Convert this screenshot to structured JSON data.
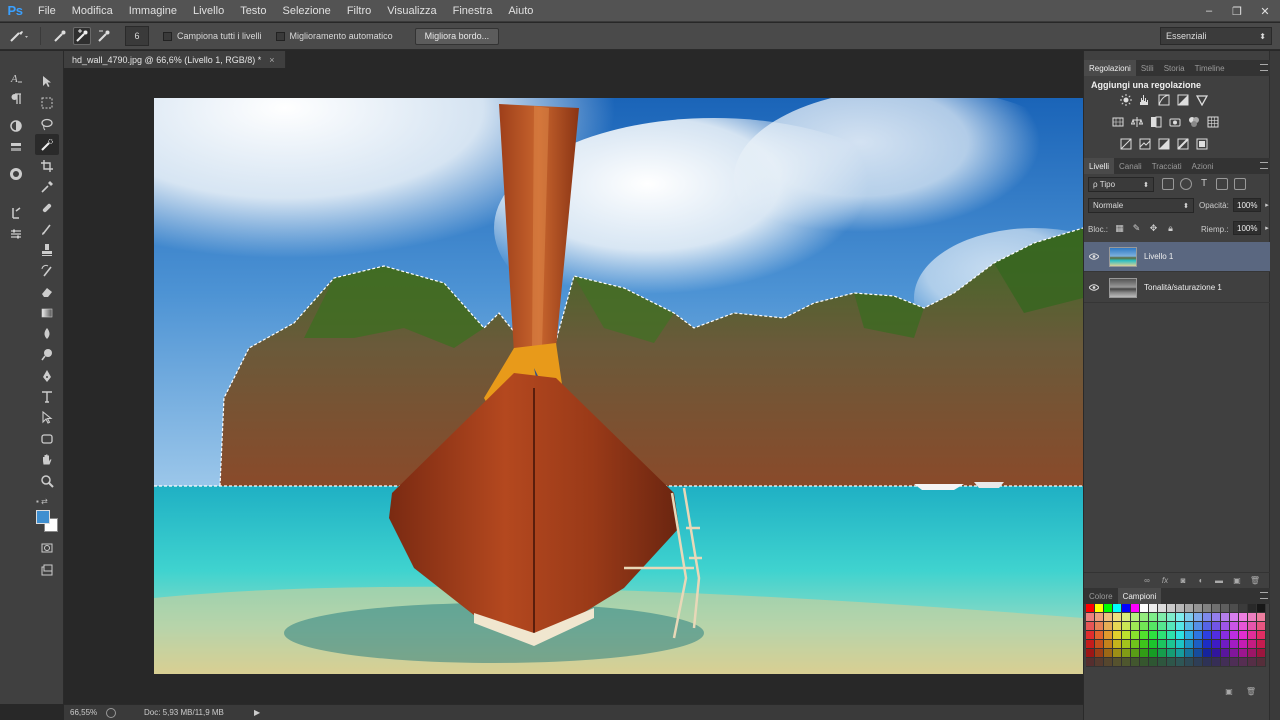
{
  "app": {
    "logo": "Ps"
  },
  "menu": [
    "File",
    "Modifica",
    "Immagine",
    "Livello",
    "Testo",
    "Selezione",
    "Filtro",
    "Visualizza",
    "Finestra",
    "Aiuto"
  ],
  "window": {
    "minimize": "–",
    "restore": "❐",
    "close": "✕"
  },
  "options": {
    "brush_size": "6",
    "sample_all": "Campiona tutti i livelli",
    "auto_enhance": "Miglioramento automatico",
    "refine_edge": "Migliora bordo...",
    "workspace": "Essenziali"
  },
  "document": {
    "tab_title": "hd_wall_4790.jpg @ 66,6% (Livello 1, RGB/8) *",
    "close": "×"
  },
  "status": {
    "zoom": "66,55%",
    "doc_size": "Doc: 5,93 MB/11,9 MB",
    "arrow": "▶"
  },
  "colors": {
    "foreground": "#3f8fd0",
    "background": "#ffffff",
    "accent": "#3aa0ff",
    "selected_layer": "#5a6780"
  },
  "panels": {
    "top_tabs": [
      "Regolazioni",
      "Stili",
      "Storia",
      "Timeline"
    ],
    "adjust_title": "Aggiungi una regolazione",
    "layer_tabs": [
      "Livelli",
      "Canali",
      "Tracciati",
      "Azioni"
    ],
    "filter_kind": "ρ Tipo",
    "blend_mode": "Normale",
    "opacity_label": "Opacità:",
    "opacity": "100%",
    "lock_label": "Bloc.:",
    "fill_label": "Riemp.:",
    "fill": "100%",
    "layers": [
      {
        "name": "Livello 1",
        "selected": true
      },
      {
        "name": "Tonalità/saturazione 1",
        "selected": false
      }
    ],
    "color_tabs": [
      "Colore",
      "Campioni"
    ]
  }
}
